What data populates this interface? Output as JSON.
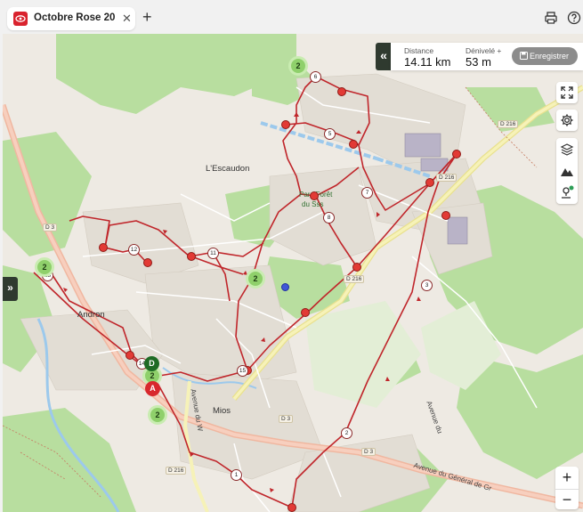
{
  "tab": {
    "title": "Octobre Rose 20…",
    "close": "✕",
    "new_tab": "+"
  },
  "toolbar": {
    "print_icon": "printer-icon",
    "help_icon": "help-circle-icon"
  },
  "stats": {
    "distance_label": "Distance",
    "distance_value": "14.11 km",
    "elevation_label": "Dénivelé +",
    "elevation_value": "53 m",
    "save_label": "Enregistrer",
    "collapse": "«"
  },
  "side_toggle": "»",
  "zoom": {
    "in": "+",
    "out": "−"
  },
  "map_labels": {
    "escaudon": "L'Escaudon",
    "andron": "Andron",
    "mios": "Mios",
    "parc_1": "Parc Forêt",
    "parc_2": "du Sss",
    "avenue_general": "Avenue du Général de Gr",
    "avenue_side": "Avenue du W",
    "avenue_lower": "Avenue du"
  },
  "road_tags": {
    "d3_a": "D 3",
    "d3_b": "D 3",
    "d3_c": "D 3",
    "d216_a": "D 216",
    "d216_b": "D 216",
    "d216_c": "D 216",
    "d216_d": "D 216"
  },
  "clusters": {
    "c1": "2",
    "c2": "2",
    "c3": "2",
    "c4": "2",
    "c5": "2"
  },
  "waypoints": {
    "w1": "1",
    "w2": "2",
    "w3": "3",
    "w5": "5",
    "w6": "6",
    "w7": "7",
    "w8": "8",
    "w11": "11",
    "w12": "12",
    "w13": "13",
    "w14": "14",
    "w15": "15"
  },
  "markers": {
    "start": "A",
    "depart": "D"
  },
  "colors": {
    "route": "#c0262b",
    "forest": "#b5dd9d",
    "road_main": "#f2b8a0",
    "road_yellow": "#f3eea4",
    "water": "#9cc9ec"
  }
}
